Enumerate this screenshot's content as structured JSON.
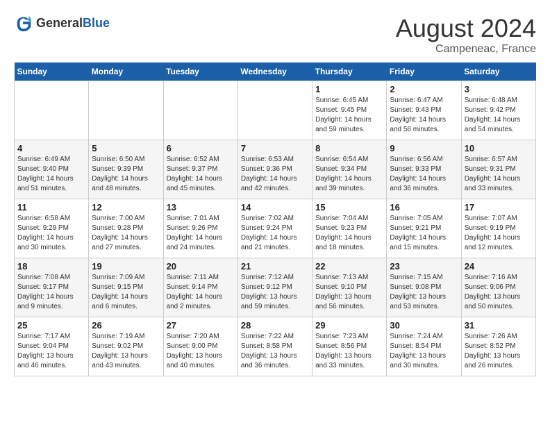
{
  "header": {
    "logo_line1": "General",
    "logo_line2": "Blue",
    "month": "August 2024",
    "location": "Campeneac, France"
  },
  "days_of_week": [
    "Sunday",
    "Monday",
    "Tuesday",
    "Wednesday",
    "Thursday",
    "Friday",
    "Saturday"
  ],
  "weeks": [
    [
      {
        "day": "",
        "info": ""
      },
      {
        "day": "",
        "info": ""
      },
      {
        "day": "",
        "info": ""
      },
      {
        "day": "",
        "info": ""
      },
      {
        "day": "1",
        "info": "Sunrise: 6:45 AM\nSunset: 9:45 PM\nDaylight: 14 hours\nand 59 minutes."
      },
      {
        "day": "2",
        "info": "Sunrise: 6:47 AM\nSunset: 9:43 PM\nDaylight: 14 hours\nand 56 minutes."
      },
      {
        "day": "3",
        "info": "Sunrise: 6:48 AM\nSunset: 9:42 PM\nDaylight: 14 hours\nand 54 minutes."
      }
    ],
    [
      {
        "day": "4",
        "info": "Sunrise: 6:49 AM\nSunset: 9:40 PM\nDaylight: 14 hours\nand 51 minutes."
      },
      {
        "day": "5",
        "info": "Sunrise: 6:50 AM\nSunset: 9:39 PM\nDaylight: 14 hours\nand 48 minutes."
      },
      {
        "day": "6",
        "info": "Sunrise: 6:52 AM\nSunset: 9:37 PM\nDaylight: 14 hours\nand 45 minutes."
      },
      {
        "day": "7",
        "info": "Sunrise: 6:53 AM\nSunset: 9:36 PM\nDaylight: 14 hours\nand 42 minutes."
      },
      {
        "day": "8",
        "info": "Sunrise: 6:54 AM\nSunset: 9:34 PM\nDaylight: 14 hours\nand 39 minutes."
      },
      {
        "day": "9",
        "info": "Sunrise: 6:56 AM\nSunset: 9:33 PM\nDaylight: 14 hours\nand 36 minutes."
      },
      {
        "day": "10",
        "info": "Sunrise: 6:57 AM\nSunset: 9:31 PM\nDaylight: 14 hours\nand 33 minutes."
      }
    ],
    [
      {
        "day": "11",
        "info": "Sunrise: 6:58 AM\nSunset: 9:29 PM\nDaylight: 14 hours\nand 30 minutes."
      },
      {
        "day": "12",
        "info": "Sunrise: 7:00 AM\nSunset: 9:28 PM\nDaylight: 14 hours\nand 27 minutes."
      },
      {
        "day": "13",
        "info": "Sunrise: 7:01 AM\nSunset: 9:26 PM\nDaylight: 14 hours\nand 24 minutes."
      },
      {
        "day": "14",
        "info": "Sunrise: 7:02 AM\nSunset: 9:24 PM\nDaylight: 14 hours\nand 21 minutes."
      },
      {
        "day": "15",
        "info": "Sunrise: 7:04 AM\nSunset: 9:23 PM\nDaylight: 14 hours\nand 18 minutes."
      },
      {
        "day": "16",
        "info": "Sunrise: 7:05 AM\nSunset: 9:21 PM\nDaylight: 14 hours\nand 15 minutes."
      },
      {
        "day": "17",
        "info": "Sunrise: 7:07 AM\nSunset: 9:19 PM\nDaylight: 14 hours\nand 12 minutes."
      }
    ],
    [
      {
        "day": "18",
        "info": "Sunrise: 7:08 AM\nSunset: 9:17 PM\nDaylight: 14 hours\nand 9 minutes."
      },
      {
        "day": "19",
        "info": "Sunrise: 7:09 AM\nSunset: 9:15 PM\nDaylight: 14 hours\nand 6 minutes."
      },
      {
        "day": "20",
        "info": "Sunrise: 7:11 AM\nSunset: 9:14 PM\nDaylight: 14 hours\nand 2 minutes."
      },
      {
        "day": "21",
        "info": "Sunrise: 7:12 AM\nSunset: 9:12 PM\nDaylight: 13 hours\nand 59 minutes."
      },
      {
        "day": "22",
        "info": "Sunrise: 7:13 AM\nSunset: 9:10 PM\nDaylight: 13 hours\nand 56 minutes."
      },
      {
        "day": "23",
        "info": "Sunrise: 7:15 AM\nSunset: 9:08 PM\nDaylight: 13 hours\nand 53 minutes."
      },
      {
        "day": "24",
        "info": "Sunrise: 7:16 AM\nSunset: 9:06 PM\nDaylight: 13 hours\nand 50 minutes."
      }
    ],
    [
      {
        "day": "25",
        "info": "Sunrise: 7:17 AM\nSunset: 9:04 PM\nDaylight: 13 hours\nand 46 minutes."
      },
      {
        "day": "26",
        "info": "Sunrise: 7:19 AM\nSunset: 9:02 PM\nDaylight: 13 hours\nand 43 minutes."
      },
      {
        "day": "27",
        "info": "Sunrise: 7:20 AM\nSunset: 9:00 PM\nDaylight: 13 hours\nand 40 minutes."
      },
      {
        "day": "28",
        "info": "Sunrise: 7:22 AM\nSunset: 8:58 PM\nDaylight: 13 hours\nand 36 minutes."
      },
      {
        "day": "29",
        "info": "Sunrise: 7:23 AM\nSunset: 8:56 PM\nDaylight: 13 hours\nand 33 minutes."
      },
      {
        "day": "30",
        "info": "Sunrise: 7:24 AM\nSunset: 8:54 PM\nDaylight: 13 hours\nand 30 minutes."
      },
      {
        "day": "31",
        "info": "Sunrise: 7:26 AM\nSunset: 8:52 PM\nDaylight: 13 hours\nand 26 minutes."
      }
    ]
  ]
}
